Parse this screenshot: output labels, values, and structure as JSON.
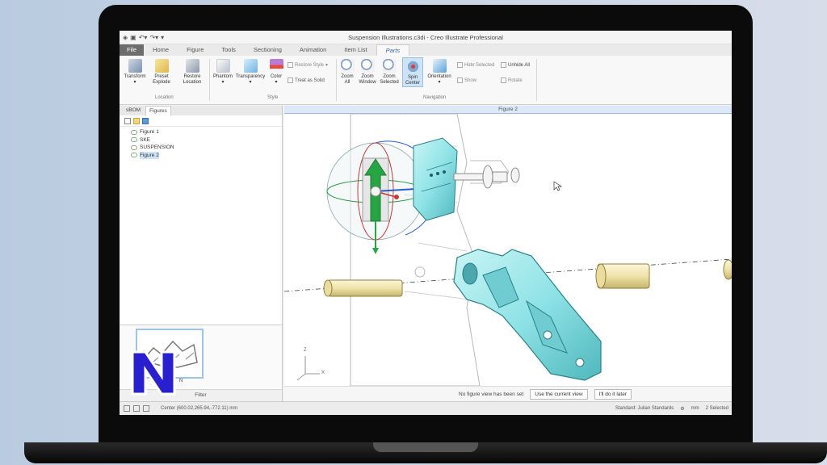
{
  "window": {
    "title": "Suspension Illustrations.c3di - Creo Illustrate Professional"
  },
  "ribbon_tabs": [
    "File",
    "Home",
    "Figure",
    "Tools",
    "Sectioning",
    "Animation",
    "Item List",
    "Parts"
  ],
  "active_tab": "Parts",
  "ribbon": {
    "transform": "Transform",
    "preset": "Preset",
    "explode": "Explode",
    "restore": "Restore",
    "location": "Location",
    "phantom": "Phantom",
    "transparency": "Transparency",
    "color": "Color",
    "restore_style": "Restore Style",
    "treat_as_solid": "Treat as Solid",
    "zoom_all_1": "Zoom",
    "zoom_all_2": "All",
    "zoom_window_1": "Zoom",
    "zoom_window_2": "Window",
    "zoom_selected_1": "Zoom",
    "zoom_selected_2": "Selected",
    "spin_center_1": "Spin",
    "spin_center_2": "Center",
    "orientation": "Orientation",
    "hide_selected": "Hide Selected",
    "unhide_all": "Unhide All",
    "show": "Show",
    "rotate": "Rotate",
    "group_location": "Location",
    "group_style": "Style",
    "group_navigation": "Navigation"
  },
  "panel": {
    "tabs": [
      "sBOM",
      "Figures"
    ],
    "tree": [
      "Figure 1",
      "SKE",
      "SUSPENSION",
      "Figure 2"
    ],
    "selected_index": 3,
    "filter_label": "Filter",
    "thumb_caption": "N"
  },
  "viewport": {
    "header": "Figure 2",
    "notice": "No figure view has been set",
    "use_current_view": "Use the current view",
    "do_it_later": "I'll do it later",
    "axis_z": "Z",
    "axis_x": "X"
  },
  "statusbar": {
    "center": "Center (600.02,265.94,-772.11) mm",
    "standard": "Standard: Julian Standards",
    "units": "mm",
    "selected": "2 Selected"
  },
  "colors": {
    "part_cyan": "#8fe3e6",
    "part_tan": "#efe3a8",
    "accent_blue": "#3a6aa8",
    "gizmo_green": "#27a545",
    "logo_blue": "#2a1fcf"
  }
}
